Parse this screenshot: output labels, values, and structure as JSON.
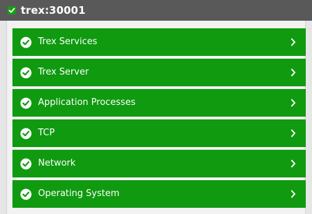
{
  "header": {
    "title": "trex:30001",
    "status_icon": "check-icon"
  },
  "items": [
    {
      "label": "Trex Services",
      "status_icon": "check-circle-icon",
      "nav_icon": "chevron-right-icon"
    },
    {
      "label": "Trex Server",
      "status_icon": "check-circle-icon",
      "nav_icon": "chevron-right-icon"
    },
    {
      "label": "Application Processes",
      "status_icon": "check-circle-icon",
      "nav_icon": "chevron-right-icon"
    },
    {
      "label": "TCP",
      "status_icon": "check-circle-icon",
      "nav_icon": "chevron-right-icon"
    },
    {
      "label": "Network",
      "status_icon": "check-circle-icon",
      "nav_icon": "chevron-right-icon"
    },
    {
      "label": "Operating System",
      "status_icon": "check-circle-icon",
      "nav_icon": "chevron-right-icon"
    }
  ],
  "colors": {
    "header_bg": "#595959",
    "item_bg": "#0f9a0f",
    "status_ok": "#169c16",
    "text": "#ffffff",
    "panel_bg": "#f2f2f2"
  }
}
